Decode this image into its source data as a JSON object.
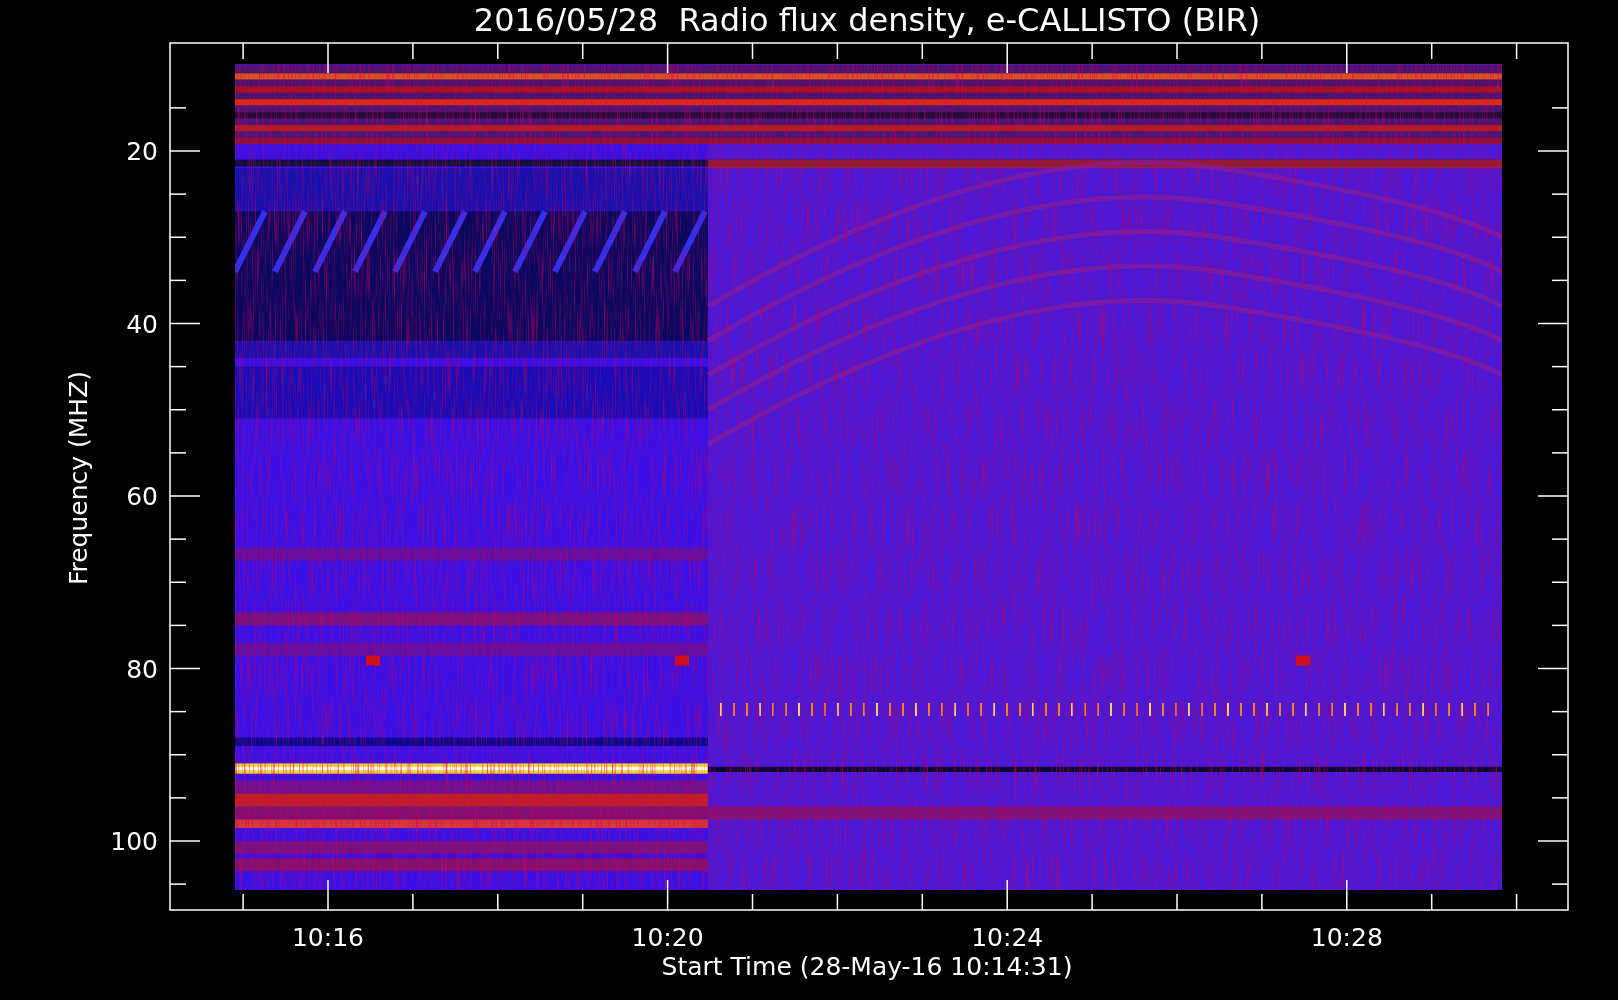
{
  "plot": {
    "title": "2016/05/28  Radio flux density, e-CALLISTO (BIR)",
    "ylabel": "Frequency (MHZ)",
    "xlabel": "Start Time (28-May-16 10:14:31)",
    "y_tick_labels": [
      "20",
      "40",
      "60",
      "80",
      "100"
    ],
    "x_tick_labels": [
      "10:16",
      "10:20",
      "10:24",
      "10:28"
    ]
  }
}
